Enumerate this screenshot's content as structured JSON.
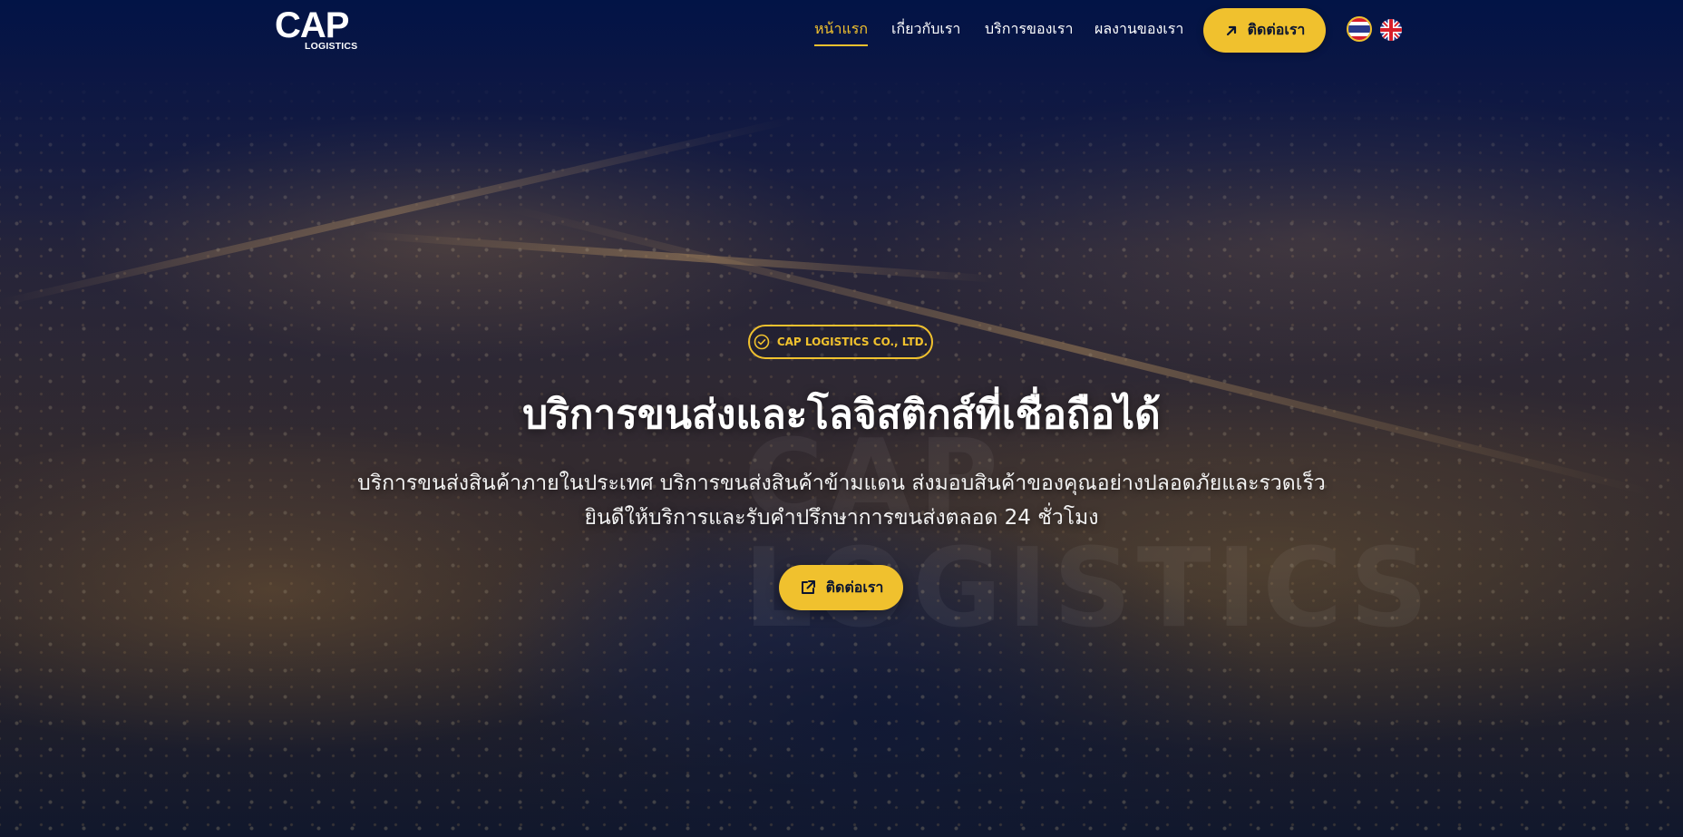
{
  "brand": {
    "logo_main": "CAP",
    "logo_sub": "LOGISTICS"
  },
  "nav": {
    "items": [
      {
        "label": "หน้าแรก",
        "active": true
      },
      {
        "label": "เกี่ยวกับเรา",
        "active": false
      },
      {
        "label": "บริการของเรา",
        "active": false
      },
      {
        "label": "ผลงานของเรา",
        "active": false
      }
    ],
    "contact_label": "ติดต่อเรา",
    "contact_icon": "arrow-up-right-icon",
    "languages": [
      {
        "code": "th",
        "icon": "thai-flag-icon",
        "selected": true
      },
      {
        "code": "en",
        "icon": "uk-flag-icon",
        "selected": false
      }
    ]
  },
  "hero": {
    "badge_icon": "check-circle-icon",
    "badge_text": "CAP LOGISTICS CO., LTD.",
    "title": "บริการขนส่งและโลจิสติกส์ที่เชื่อถือได้",
    "subtitle_line1": "บริการขนส่งสินค้าภายในประเทศ บริการขนส่งสินค้าข้ามแดน ส่งมอบสินค้าของคุณอย่างปลอดภัยและรวดเร็ว",
    "subtitle_line2": "ยินดีให้บริการและรับคำปรึกษาการขนส่งตลอด 24 ชั่วโมง",
    "cta_label": "ติดต่อเรา",
    "cta_icon": "external-link-icon",
    "watermark_line1": "CAP",
    "watermark_line2": "LOGISTICS"
  },
  "colors": {
    "accent": "#f0c12e",
    "header_bg": "#021446",
    "text_dark": "#0b1530"
  }
}
